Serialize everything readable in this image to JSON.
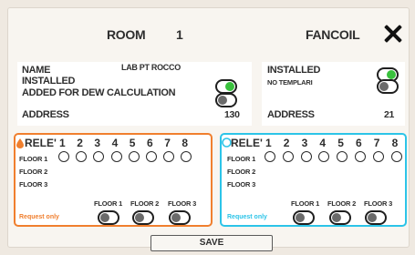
{
  "header": {
    "room_label": "ROOM",
    "room_number": "1",
    "device": "FANCOIL"
  },
  "left_info": {
    "name_label": "NAME",
    "name_value": "LAB PT ROCCO",
    "installed_label": "INSTALLED",
    "dew_label": "ADDED FOR DEW CALCULATION",
    "address_label": "ADDRESS",
    "address_value": "130",
    "installed_on": true,
    "dew_on": false
  },
  "right_info": {
    "installed_label": "INSTALLED",
    "sub_label": "NO TEMPLARI",
    "address_label": "ADDRESS",
    "address_value": "21",
    "installed_on": true,
    "second_on": false
  },
  "relays": {
    "rele_label": "RELE'",
    "numbers": [
      "1",
      "2",
      "3",
      "4",
      "5",
      "6",
      "7",
      "8"
    ],
    "floor1": "FLOOR 1",
    "floor2": "FLOOR 2",
    "floor3": "FLOOR 3",
    "request_only": "Request only",
    "colors": {
      "left": "#f07f2e",
      "right": "#2cc4e8"
    }
  },
  "footer": {
    "save_label": "SAVE"
  }
}
